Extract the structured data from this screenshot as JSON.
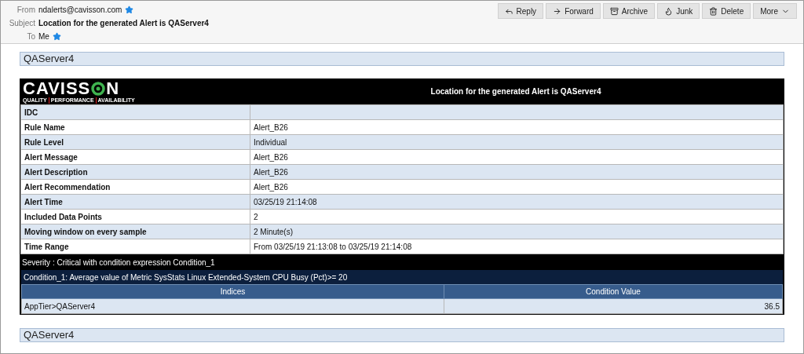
{
  "header": {
    "fields": [
      {
        "label": "From",
        "value": "ndalerts@cavisson.com",
        "starred": true,
        "bold": false
      },
      {
        "label": "Subject",
        "value": "Location for the generated Alert is QAServer4",
        "starred": false,
        "bold": true
      },
      {
        "label": "To",
        "value": "Me",
        "starred": true,
        "bold": false
      }
    ],
    "buttons": [
      {
        "label": "Reply"
      },
      {
        "label": "Forward"
      },
      {
        "label": "Archive"
      },
      {
        "label": "Junk"
      },
      {
        "label": "Delete"
      },
      {
        "label": "More"
      }
    ]
  },
  "server_top": "QAServer4",
  "banner": {
    "logo": {
      "before": "CAVISS",
      "after": "N",
      "tagline": [
        "QUALITY",
        "PERFORMANCE",
        "AVAILABILITY"
      ]
    },
    "title": "Location for the generated Alert is QAServer4"
  },
  "details": [
    {
      "key": "IDC"
    },
    {
      "key": "Rule Name",
      "value": "Alert_B26"
    },
    {
      "key": "Rule Level",
      "value": "Individual"
    },
    {
      "key": "Alert Message",
      "value": "Alert_B26"
    },
    {
      "key": "Alert Description",
      "value": "Alert_B26"
    },
    {
      "key": "Alert Recommendation",
      "value": "Alert_B26"
    },
    {
      "key": "Alert Time",
      "value": "03/25/19 21:14:08"
    },
    {
      "key": "Included Data Points",
      "value": "2"
    },
    {
      "key": "Moving window on every sample",
      "value": "2 Minute(s)"
    },
    {
      "key": "Time Range",
      "value": "From 03/25/19 21:13:08 to 03/25/19 21:14:08"
    }
  ],
  "severity": "Severity : Critical with condition expression Condition_1",
  "condition": {
    "title": "Condition_1: Average value of Metric SysStats Linux Extended-System CPU Busy (Pct)>= 20",
    "columns": [
      "Indices",
      "Condition Value"
    ],
    "rows": [
      [
        "AppTier>QAServer4",
        "36.5"
      ]
    ]
  },
  "server_bottom": "QAServer4"
}
